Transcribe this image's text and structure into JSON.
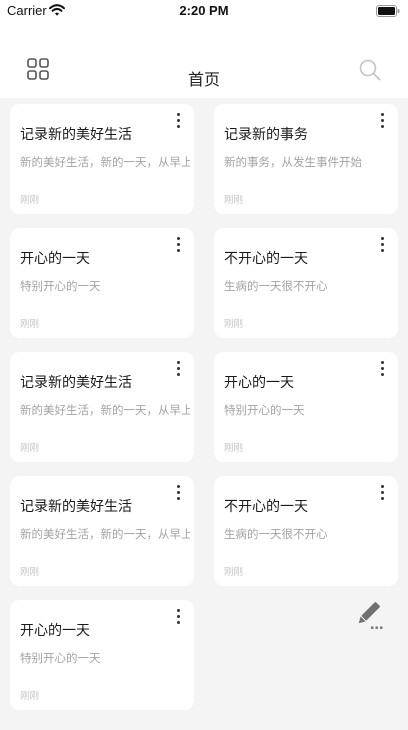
{
  "status": {
    "carrier": "Carrier",
    "time": "2:20 PM"
  },
  "header": {
    "title": "首页"
  },
  "icons": {
    "menu": "grid-icon",
    "search": "search-icon",
    "more": "more-vertical-icon",
    "edit": "edit-pencil-icon"
  },
  "colors": {
    "background": "#f4f4f4",
    "card": "#ffffff",
    "title_text": "#1a1a1a",
    "secondary_text": "#a3a3a3"
  },
  "notes": [
    {
      "title": "记录新的美好生活",
      "desc": "新的美好生活，新的一天，从早上开始",
      "time": "刚刚"
    },
    {
      "title": "记录新的事务",
      "desc": "新的事务，从发生事件开始",
      "time": "刚刚"
    },
    {
      "title": "开心的一天",
      "desc": "特别开心的一天",
      "time": "刚刚"
    },
    {
      "title": "不开心的一天",
      "desc": "生病的一天很不开心",
      "time": "刚刚"
    },
    {
      "title": "记录新的美好生活",
      "desc": "新的美好生活，新的一天，从早上开始",
      "time": "刚刚"
    },
    {
      "title": "开心的一天",
      "desc": "特别开心的一天",
      "time": "刚刚"
    },
    {
      "title": "记录新的美好生活",
      "desc": "新的美好生活，新的一天，从早上开始",
      "time": "刚刚"
    },
    {
      "title": "不开心的一天",
      "desc": "生病的一天很不开心",
      "time": "刚刚"
    },
    {
      "title": "开心的一天",
      "desc": "特别开心的一天",
      "time": "刚刚"
    }
  ]
}
